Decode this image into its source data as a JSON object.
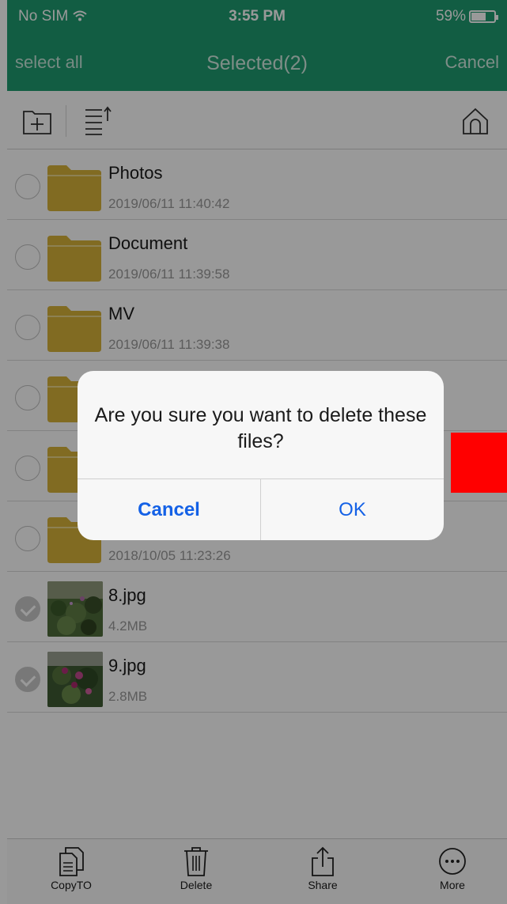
{
  "status_bar": {
    "carrier": "No SIM",
    "time": "3:55 PM",
    "battery": "59%"
  },
  "nav": {
    "left": "select all",
    "title": "Selected(2)",
    "right": "Cancel"
  },
  "files": [
    {
      "name": "Photos",
      "meta": "2019/06/11 11:40:42",
      "type": "folder",
      "selected": false
    },
    {
      "name": "Document",
      "meta": "2019/06/11 11:39:58",
      "type": "folder",
      "selected": false
    },
    {
      "name": "MV",
      "meta": "2019/06/11 11:39:38",
      "type": "folder",
      "selected": false
    },
    {
      "name": "",
      "meta": "",
      "type": "folder",
      "selected": false
    },
    {
      "name": "",
      "meta": "",
      "type": "folder",
      "selected": false
    },
    {
      "name": "",
      "meta": "2018/10/05 11:23:26",
      "type": "folder",
      "selected": false
    },
    {
      "name": "8.jpg",
      "meta": "4.2MB",
      "type": "image",
      "selected": true
    },
    {
      "name": "9.jpg",
      "meta": "2.8MB",
      "type": "image",
      "selected": true
    }
  ],
  "tabbar": {
    "copy": "CopyTO",
    "delete": "Delete",
    "share": "Share",
    "more": "More"
  },
  "alert": {
    "message": "Are you sure you want to delete these files?",
    "cancel": "Cancel",
    "ok": "OK"
  },
  "colors": {
    "header": "#1f9b70",
    "folder": "#d8b23a",
    "alert_button": "#1461e6",
    "marker": "#ff0000"
  }
}
